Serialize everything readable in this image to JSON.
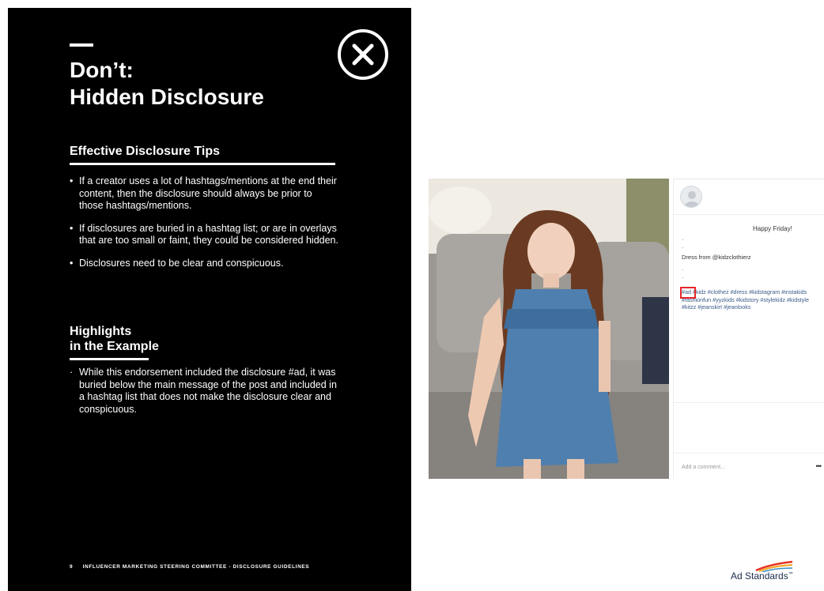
{
  "slide": {
    "title_line1": "Don’t:",
    "title_line2": "Hidden Disclosure",
    "tips_heading": "Effective Disclosure Tips",
    "tips": [
      "If a creator uses a lot of hashtags/mentions at the end their content, then the disclosure should always be prior to those hashtags/mentions.",
      "If disclosures are buried in a hashtag list; or are in overlays that are too small or faint, they could be considered hidden.",
      "Disclosures need to be clear and conspicuous."
    ],
    "highlights_heading_line1": "Highlights",
    "highlights_heading_line2": "in the Example",
    "highlights": [
      "While this endorsement included the disclosure #ad, it was buried below the main message of the post and included in a hashtag list that does not make the disclosure clear and conspicuous."
    ],
    "footer_page": "9",
    "footer_text": "INFLUENCER MARKETING STEERING COMMITTEE - DISCLOSURE GUIDELINES"
  },
  "post": {
    "greeting": "Happy Friday!",
    "dots": [
      ".",
      ".",
      ".",
      "."
    ],
    "caption": "Dress from @kidzclothierz",
    "hashtags": "#ad #kidz #clothez #dress #kidstagram #instakids #fashionfun #yyzkids #kidstory #stylekidz #kidstyle #kitzz #jeanskirt #jeanlooks",
    "comment_placeholder": "Add a comment...",
    "more": "•••"
  },
  "brand": {
    "logo_text": "Ad Standards",
    "trademark": "™"
  },
  "colors": {
    "panel_bg": "#000000",
    "highlight_box": "#e8262a",
    "hashtag_link": "#3b5b8a"
  },
  "icons": {
    "close": "close-circle-icon",
    "avatar": "user-avatar-icon",
    "more": "more-dots-icon",
    "logo": "ad-standards-logo"
  }
}
